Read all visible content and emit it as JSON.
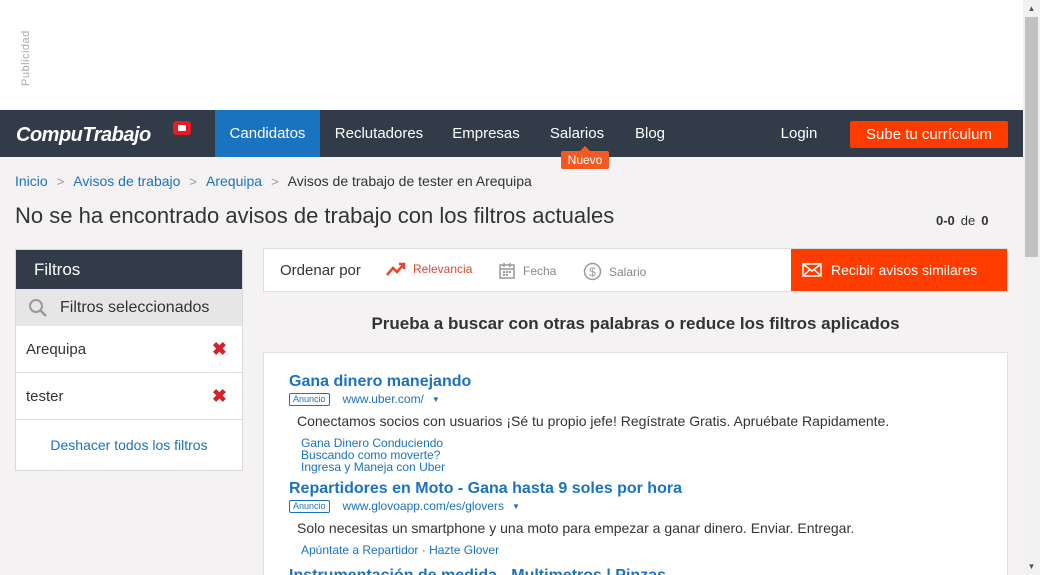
{
  "ad_label": "Publicidad",
  "header": {
    "logo": "CompuTrabajo",
    "nav": [
      "Candidatos",
      "Reclutadores",
      "Empresas",
      "Salarios",
      "Blog"
    ],
    "badge": "Nuevo",
    "login": "Login",
    "cta": "Sube tu currículum"
  },
  "breadcrumb": {
    "items": [
      "Inicio",
      "Avisos de trabajo",
      "Arequipa"
    ],
    "current": "Avisos de trabajo de tester en Arequipa",
    "separator": ">"
  },
  "page": {
    "title": "No se ha encontrado avisos de trabajo con los filtros actuales",
    "count_range": "0-0",
    "count_of": "de",
    "count_total": "0"
  },
  "filters": {
    "title": "Filtros",
    "selected_label": "Filtros seleccionados",
    "items": [
      "Arequipa",
      "tester"
    ],
    "remove_glyph": "✖",
    "undo": "Deshacer todos los filtros"
  },
  "sort": {
    "label": "Ordenar por",
    "options": [
      "Relevancia",
      "Fecha",
      "Salario"
    ],
    "active": "Relevancia",
    "alert_button": "Recibir avisos similares"
  },
  "hint": "Prueba a buscar con otras palabras o reduce los filtros aplicados",
  "ads": [
    {
      "title": "Gana dinero manejando",
      "tag": "Anuncio",
      "url": "www.uber.com/",
      "desc": "Conectamos socios con usuarios ¡Sé tu propio jefe! Regístrate Gratis. Apruébate Rapidamente.",
      "links": [
        "Gana Dinero Conduciendo",
        "Buscando como moverte?",
        "Ingresa y Maneja con Uber"
      ]
    },
    {
      "title": "Repartidores en Moto - Gana hasta 9 soles por hora",
      "tag": "Anuncio",
      "url": "www.glovoapp.com/es/glovers",
      "desc": "Solo necesitas un smartphone y una moto para empezar a ganar dinero. Enviar. Entregar.",
      "links_inline": "Apúntate a Repartidor · Hazte Glover"
    },
    {
      "title": "Instrumentación de medida - Multimetros | Pinzas"
    }
  ],
  "colors": {
    "header_bg": "#323b48",
    "nav_active": "#1a73be",
    "accent": "#ff3c00",
    "link": "#1a73be",
    "remove": "#d2232a"
  }
}
